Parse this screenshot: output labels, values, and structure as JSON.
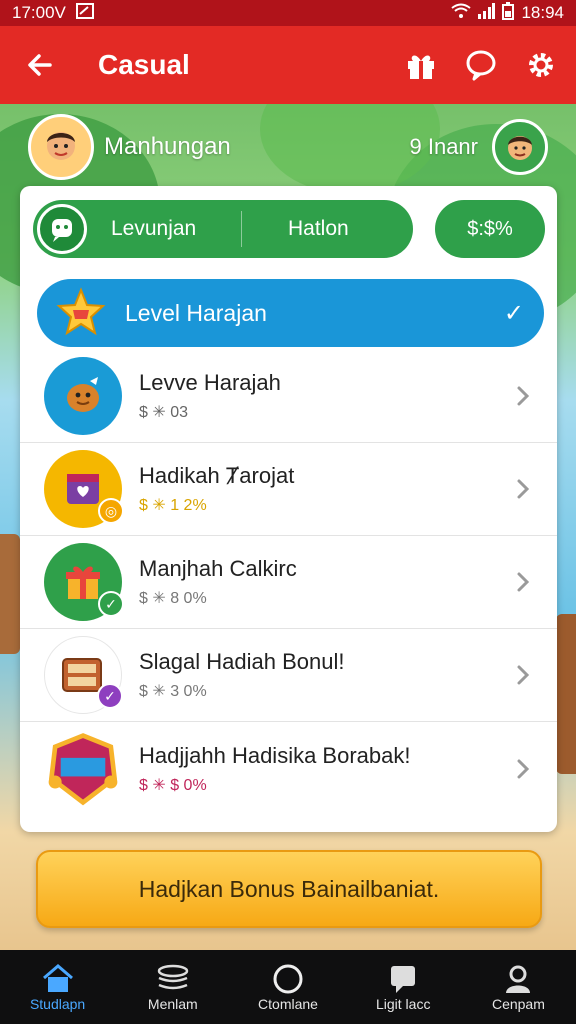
{
  "status_bar": {
    "time": "17:00V",
    "right_time": "18:94"
  },
  "app_bar": {
    "title": "Casual",
    "back_icon": "arrow-left-icon",
    "actions": [
      "gift-icon",
      "chat-icon",
      "gear-icon"
    ]
  },
  "profile": {
    "name": "Manhungan",
    "right_text": "9 Inanr"
  },
  "segment": {
    "left_label": "Levunjan",
    "right_label": "Hatlon",
    "balance": "$:$%"
  },
  "level_banner": {
    "label": "Level Harajan",
    "check": "✓"
  },
  "list": [
    {
      "title": "Levve Harajah",
      "sub": "$ ✳ 03",
      "icon_bg": "#1a9bd6",
      "sub_color": "#666666",
      "badge": "",
      "badge_color": ""
    },
    {
      "title": "Hadikah Ⱦarojat",
      "sub": "$ ✳ 1 2%",
      "icon_bg": "#f5b700",
      "sub_color": "#d9a400",
      "badge": "◎",
      "badge_color": "#f5a600"
    },
    {
      "title": "Manjhah Calkirc",
      "sub": "$ ✳ 8 0%",
      "icon_bg": "#2fa04a",
      "sub_color": "#777777",
      "badge": "✓",
      "badge_color": "#2fa04a"
    },
    {
      "title": "Slagal Hadiah Bonul!",
      "sub": "$ ✳ 3 0%",
      "icon_bg": "#ffffff",
      "sub_color": "#777777",
      "badge": "✓",
      "badge_color": "#8e3fbf"
    },
    {
      "title": "Hadjjahh Hadisika Borabak!",
      "sub": "$ ✳ $ 0%",
      "icon_bg": "#ffffff",
      "sub_color": "#c0265a",
      "badge": "",
      "badge_color": ""
    }
  ],
  "bonus_button": "Hadjkan Bonus Bainailbaniat.",
  "bottom_nav": [
    {
      "label": "Studlapn",
      "icon": "home-icon",
      "active": true
    },
    {
      "label": "Menlam",
      "icon": "layers-icon",
      "active": false
    },
    {
      "label": "Ctomlane",
      "icon": "circle-icon",
      "active": false
    },
    {
      "label": "Ligit lacc",
      "icon": "message-icon",
      "active": false
    },
    {
      "label": "Cenpam",
      "icon": "profile-icon",
      "active": false
    }
  ]
}
